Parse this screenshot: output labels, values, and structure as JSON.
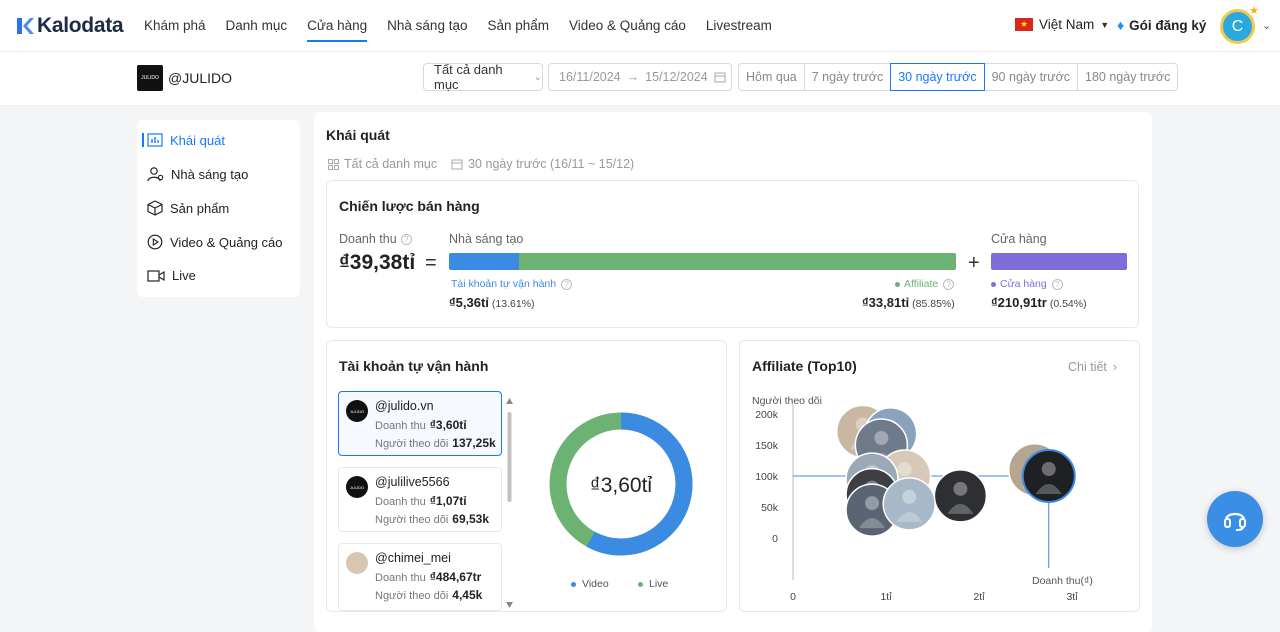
{
  "brand": {
    "name": "Kalodata"
  },
  "nav": {
    "items": [
      "Khám phá",
      "Danh mục",
      "Cửa hàng",
      "Nhà sáng tạo",
      "Sản phẩm",
      "Video & Quảng cáo",
      "Livestream"
    ],
    "active": "Cửa hàng"
  },
  "header": {
    "country": "Việt Nam",
    "subscribe": "Gói đăng ký",
    "avatar_letter": "C"
  },
  "shop": {
    "name": "@JULIDO",
    "logo_text": "JULIDO"
  },
  "filters": {
    "category": "Tất cả danh mục",
    "date_from": "16/11/2024",
    "date_to": "15/12/2024",
    "periods": [
      "Hôm qua",
      "7 ngày trước",
      "30 ngày trước",
      "90 ngày trước",
      "180 ngày trước"
    ],
    "active_period": "30 ngày trước"
  },
  "sidebar": {
    "items": [
      {
        "label": "Khái quát",
        "icon": "bar-chart-icon"
      },
      {
        "label": "Nhà sáng tạo",
        "icon": "users-icon"
      },
      {
        "label": "Sản phẩm",
        "icon": "box-icon"
      },
      {
        "label": "Video & Quảng cáo",
        "icon": "play-icon"
      },
      {
        "label": "Live",
        "icon": "video-camera-icon"
      }
    ],
    "active": "Khái quát"
  },
  "overview": {
    "title": "Khái quát",
    "meta_category": "Tất cả danh mục",
    "meta_period": "30 ngày trước (16/11 ~ 15/12)"
  },
  "strategy": {
    "title": "Chiến lược bán hàng",
    "revenue_label": "Doanh thu",
    "revenue_value": "₫39,38tỉ",
    "creator_label": "Nhà sáng tạo",
    "store_label": "Cửa hàng",
    "self_label": "Tài khoản tự vận hành",
    "self_value": "₫5,36tỉ",
    "self_pct": "(13.61%)",
    "self_share": 0.1372,
    "affiliate_label": "Affiliate",
    "affiliate_value": "₫33,81tỉ",
    "affiliate_pct": "(85.85%)",
    "affiliate_share": 0.8628,
    "store_sub_label": "Cửa hàng",
    "store_value": "₫210,91tr",
    "store_pct": "(0.54%)",
    "colors": {
      "self": "#3b8be3",
      "affiliate": "#6bb273",
      "store": "#7f6ddc"
    }
  },
  "self_accounts": {
    "title": "Tài khoản tự vận hành",
    "revenue_label": "Doanh thu",
    "followers_label": "Người theo dõi",
    "items": [
      {
        "handle": "@julido.vn",
        "revenue": "₫3,60tỉ",
        "followers": "137,25k"
      },
      {
        "handle": "@julilive5566",
        "revenue": "₫1,07tỉ",
        "followers": "69,53k"
      },
      {
        "handle": "@chimei_mei",
        "revenue": "₫484,67tr",
        "followers": "4,45k"
      }
    ],
    "donut_center": "₫3,60tỉ",
    "donut_video_share": 0.58,
    "legend": [
      {
        "label": "Video",
        "color": "#3b8be3"
      },
      {
        "label": "Live",
        "color": "#6bb273"
      }
    ]
  },
  "affiliate": {
    "title": "Affiliate (Top10)",
    "detail_link": "Chi tiết",
    "y_axis_label": "Người theo dõi",
    "x_axis_label": "Doanh thu(₫)",
    "y_ticks": [
      "200k",
      "150k",
      "100k",
      "50k",
      "0"
    ],
    "x_ticks": [
      "0",
      "1tỉ",
      "2tỉ",
      "3tỉ"
    ]
  },
  "chart_data": {
    "type": "scatter",
    "title": "Affiliate (Top10)",
    "xlabel": "Doanh thu(₫)",
    "ylabel": "Người theo dõi",
    "x_unit": "tỉ",
    "xlim": [
      0,
      3
    ],
    "ylim": [
      0,
      200000
    ],
    "y_ticks": [
      0,
      50000,
      100000,
      150000,
      200000
    ],
    "x_ticks": [
      0,
      1,
      2,
      3
    ],
    "points": [
      {
        "x": 0.75,
        "y": 172000
      },
      {
        "x": 1.05,
        "y": 168000
      },
      {
        "x": 0.95,
        "y": 150000
      },
      {
        "x": 1.2,
        "y": 100000
      },
      {
        "x": 0.85,
        "y": 95000
      },
      {
        "x": 0.85,
        "y": 70000
      },
      {
        "x": 0.85,
        "y": 45000
      },
      {
        "x": 1.25,
        "y": 55000
      },
      {
        "x": 1.8,
        "y": 68000
      },
      {
        "x": 2.6,
        "y": 110000
      },
      {
        "x": 2.75,
        "y": 100000
      }
    ],
    "highlight": {
      "x": 2.75,
      "y": 100000
    }
  }
}
